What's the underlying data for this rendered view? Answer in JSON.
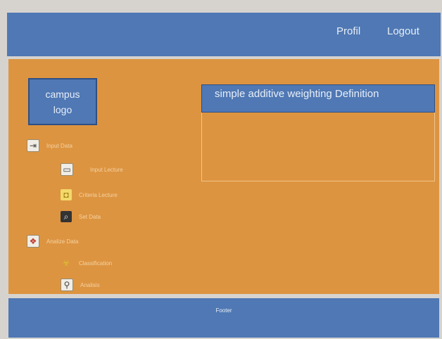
{
  "header": {
    "profil_label": "Profil",
    "logout_label": "Logout",
    "background": "#4f78b4"
  },
  "sidebar": {
    "logo": {
      "line1": "campus",
      "line2": "logo"
    },
    "items": [
      {
        "label": "Input Data",
        "icon": "login-icon"
      },
      {
        "label": "Input Lecture",
        "icon": "folder-icon"
      },
      {
        "label": "Criteria Lecture",
        "icon": "criteria-icon"
      },
      {
        "label": "Set Data",
        "icon": "search-data-icon"
      },
      {
        "label": "Analize Data",
        "icon": "analysis-icon"
      },
      {
        "label": "Classification",
        "icon": "biohazard-icon"
      },
      {
        "label": "Analisis",
        "icon": "zoom-chart-icon"
      }
    ]
  },
  "content": {
    "card_title": "simple additive weighting Definition",
    "background": "#dd9440"
  },
  "footer": {
    "text": "Footer"
  }
}
